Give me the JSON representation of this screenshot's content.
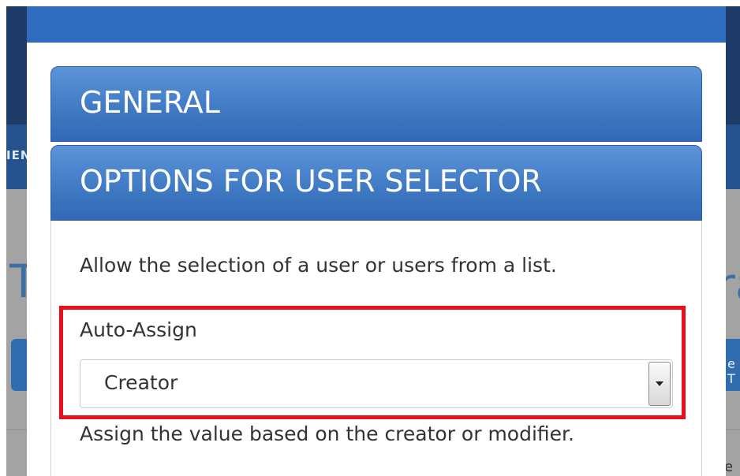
{
  "background": {
    "nav_fragment": "IEN",
    "heading_left_fragment": "T",
    "heading_right_fragment": "ra",
    "button_right_fragment": "e T",
    "trailing_fragment": "e"
  },
  "modal": {
    "sections": [
      {
        "title": "GENERAL"
      },
      {
        "title": "OPTIONS FOR USER SELECTOR"
      }
    ],
    "user_selector": {
      "description": "Allow the selection of a user or users from a list.",
      "auto_assign": {
        "label": "Auto-Assign",
        "selected_value": "Creator",
        "help_text": "Assign the value based on the creator or modifier."
      }
    }
  },
  "colors": {
    "highlight": "#e8101c",
    "panel_header": "#3b74be",
    "modal_header": "#2f6cc0"
  },
  "icons": {
    "dropdown": "chevron-down-icon"
  }
}
